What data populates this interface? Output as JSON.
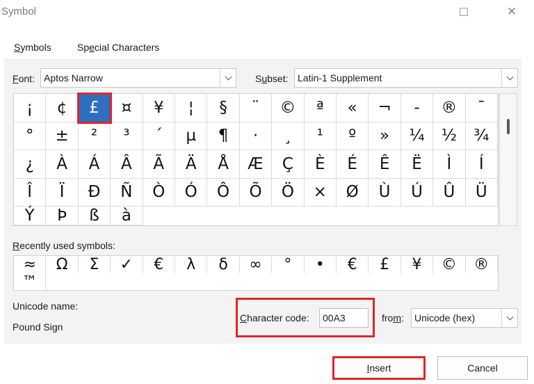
{
  "window": {
    "title": "Symbol",
    "maximize_glyph": "☐",
    "close_glyph": "✕"
  },
  "tabs": [
    {
      "label_pre": "",
      "label_key": "S",
      "label_post": "ymbols"
    },
    {
      "label_pre": "Sp",
      "label_key": "e",
      "label_post": "cial Characters"
    }
  ],
  "font": {
    "label_key": "F",
    "label_post": "ont:",
    "value": "Aptos Narrow"
  },
  "subset": {
    "label_pre": "S",
    "label_key": "u",
    "label_post": "bset:",
    "value": "Latin-1 Supplement"
  },
  "symbol_grid": {
    "rows": [
      [
        "¡",
        "¢",
        "£",
        "¤",
        "¥",
        "¦",
        "§",
        "¨",
        "©",
        "ª",
        "«",
        "¬",
        "-",
        "®",
        "¯",
        "°"
      ],
      [
        "±",
        "²",
        "³",
        "´",
        "µ",
        "¶",
        "·",
        "¸",
        "¹",
        "º",
        "»",
        "¼",
        "½",
        "¾",
        "¿",
        "À"
      ],
      [
        "Á",
        "Â",
        "Ã",
        "Ä",
        "Å",
        "Æ",
        "Ç",
        "È",
        "É",
        "Ê",
        "Ë",
        "Ì",
        "Í",
        "Î",
        "Ï",
        "Ð"
      ],
      [
        "Ñ",
        "Ò",
        "Ó",
        "Ô",
        "Õ",
        "Ö",
        "×",
        "Ø",
        "Ù",
        "Ú",
        "Û",
        "Ü",
        "Ý",
        "Þ",
        "ß",
        "à"
      ]
    ],
    "selected_row": 0,
    "selected_col": 2
  },
  "recent": {
    "label_key": "R",
    "label_post": "ecently used symbols:",
    "symbols": [
      "≈",
      "Ω",
      "Σ",
      "✓",
      "€",
      "λ",
      "δ",
      "∞",
      "°",
      "•",
      "€",
      "£",
      "¥",
      "©",
      "®",
      "™"
    ]
  },
  "unicode_name": {
    "label": "Unicode name:",
    "value": "Pound Sign"
  },
  "character_code": {
    "label_key": "C",
    "label_post": "haracter code:",
    "value": "00A3"
  },
  "from": {
    "label_pre": "fro",
    "label_key": "m",
    "label_post": ":",
    "value": "Unicode (hex)"
  },
  "buttons": {
    "insert": {
      "label_key": "I",
      "label_post": "nsert"
    },
    "cancel": {
      "label": "Cancel"
    }
  },
  "colors": {
    "highlight": "#e0252b",
    "selection": "#2f6fbf"
  }
}
